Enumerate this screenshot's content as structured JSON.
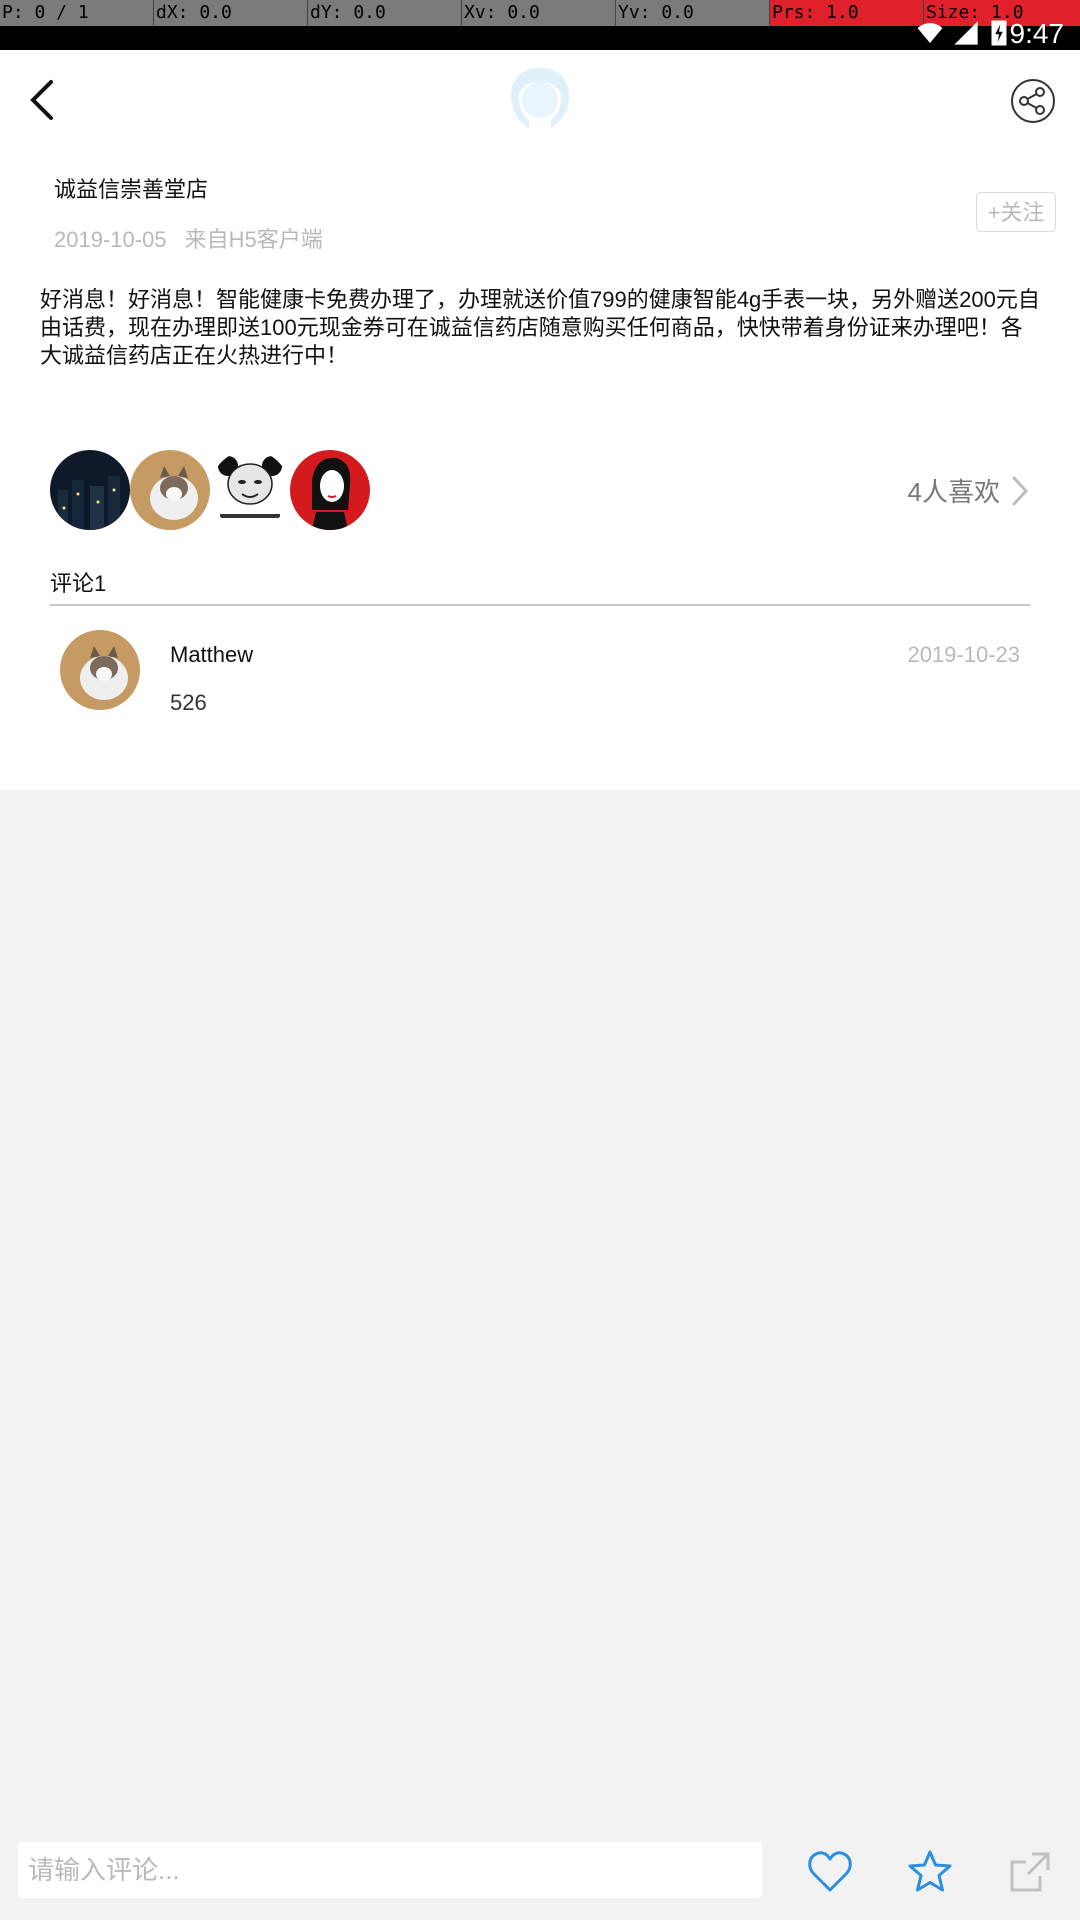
{
  "debug_bar": {
    "pointer": "P: 0 / 1",
    "dx": "dX: 0.0",
    "dy": "dY: 0.0",
    "xv": "Xv: 0.0",
    "yv": "Yv: 0.0",
    "prs": "Prs: 1.0",
    "size": "Size: 1.0"
  },
  "status_bar": {
    "time": "9:47",
    "icons": [
      "wifi-icon",
      "cell-signal-icon",
      "battery-icon"
    ]
  },
  "header": {
    "back_icon": "chevron-left-icon",
    "avatar_icon": "user-avatar-icon",
    "share_icon": "share-icon"
  },
  "post": {
    "shop_name": "诚益信崇善堂店",
    "date": "2019-10-05",
    "source": "来自H5客户端",
    "follow_label": "+关注",
    "text": "好消息！好消息！智能健康卡免费办理了，办理就送价值799的健康智能4g手表一块，另外赠送200元自由话费，现在办理即送100元现金券可在诚益信药店随意购买任何商品，快快带着身份证来办理吧！各大诚益信药店正在火热进行中！"
  },
  "likes": {
    "count_label": "4人喜欢",
    "avatars": [
      "night-city-avatar",
      "cat-avatar",
      "meme-avatar",
      "woman-portrait-avatar"
    ]
  },
  "comments": {
    "header_label": "评论1",
    "items": [
      {
        "author": "Matthew",
        "date": "2019-10-23",
        "text": "526"
      }
    ]
  },
  "bottom_bar": {
    "input_placeholder": "请输入评论...",
    "icons": [
      "heart-icon",
      "star-icon",
      "external-share-icon"
    ]
  },
  "colors": {
    "accent": "#2a8fe0",
    "meta_text": "#b9b9b9",
    "background": "#f2f2f2"
  }
}
